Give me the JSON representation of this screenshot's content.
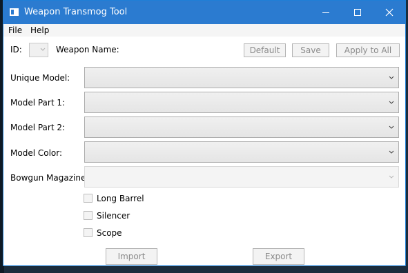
{
  "window": {
    "title": "Weapon Transmog Tool",
    "accent": "#2b7bd0"
  },
  "menu": {
    "file": "File",
    "help": "Help"
  },
  "header": {
    "id_label": "ID:",
    "weapon_name_label": "Weapon Name:",
    "default_button": "Default",
    "save_button": "Save",
    "apply_all_button": "Apply to All"
  },
  "fields": [
    {
      "label": "Unique Model:",
      "value": "",
      "enabled": true
    },
    {
      "label": "Model Part 1:",
      "value": "",
      "enabled": true
    },
    {
      "label": "Model Part 2:",
      "value": "",
      "enabled": true
    },
    {
      "label": "Model Color:",
      "value": "",
      "enabled": true
    },
    {
      "label": "Bowgun Magazine:",
      "value": "",
      "enabled": false
    }
  ],
  "options": [
    {
      "label": "Long Barrel",
      "checked": false
    },
    {
      "label": "Silencer",
      "checked": false
    },
    {
      "label": "Scope",
      "checked": false
    }
  ],
  "footer": {
    "import_button": "Import",
    "export_button": "Export"
  }
}
